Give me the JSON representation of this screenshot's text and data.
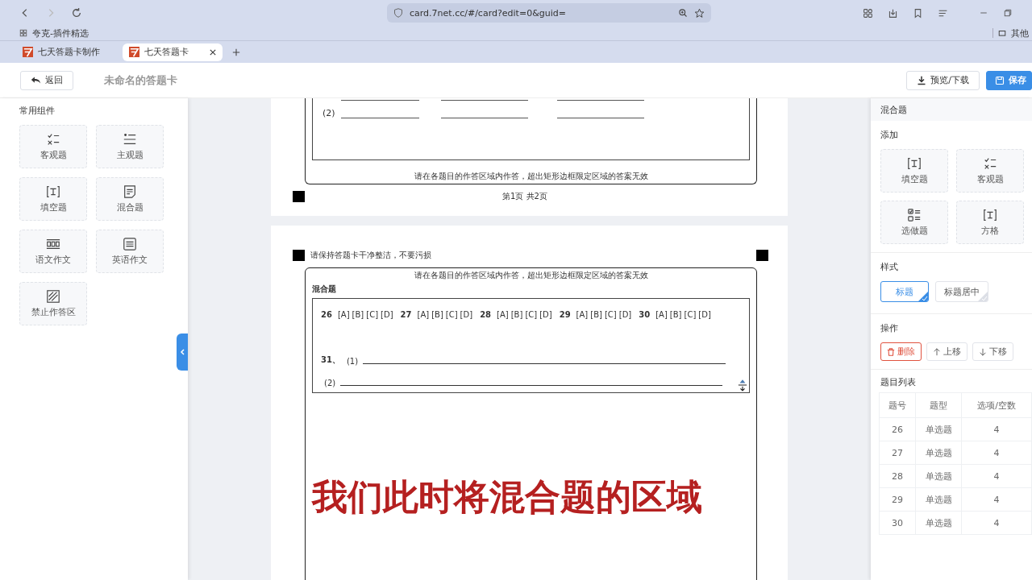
{
  "browser": {
    "url": "card.7net.cc/#/card?edit=0&guid=",
    "bookmarks": [
      "夸克-插件精选"
    ],
    "bookmark_folder": "其他",
    "tabs": [
      {
        "label": "七天答题卡制作",
        "selected": false
      },
      {
        "label": "七天答题卡",
        "selected": true
      }
    ]
  },
  "header": {
    "back_button": "返回",
    "title": "未命名的答题卡",
    "preview_button": "预览/下载",
    "save_button": "保存"
  },
  "left_panel": {
    "title": "常用组件",
    "components": [
      "客观题",
      "主观题",
      "填空题",
      "混合题",
      "语文作文",
      "英语作文",
      "禁止作答区"
    ]
  },
  "page_1": {
    "blank_label": "(2)",
    "answer_note": "请在各题目的作答区域内作答，超出矩形边框限定区域的答案无效",
    "page_number": "第1页 共2页"
  },
  "page_2": {
    "notice": "请保持答题卡干净整洁，不要污损",
    "answer_note": "请在各题目的作答区域内作答，超出矩形边框限定区域的答案无效",
    "section_title": "混合题",
    "choices": [
      {
        "number": "26",
        "options": [
          "[A]",
          "[B]",
          "[C]",
          "[D]"
        ]
      },
      {
        "number": "27",
        "options": [
          "[A]",
          "[B]",
          "[C]",
          "[D]"
        ]
      },
      {
        "number": "28",
        "options": [
          "[A]",
          "[B]",
          "[C]",
          "[D]"
        ]
      },
      {
        "number": "29",
        "options": [
          "[A]",
          "[B]",
          "[C]",
          "[D]"
        ]
      },
      {
        "number": "30",
        "options": [
          "[A]",
          "[B]",
          "[C]",
          "[D]"
        ]
      }
    ],
    "fill": {
      "number": "31、",
      "parts": [
        "(1)",
        "(2)"
      ]
    }
  },
  "caption": "我们此时将混合题的区域",
  "right_panel": {
    "title": "混合题",
    "add_label": "添加",
    "add_items": [
      "填空题",
      "客观题",
      "选做题",
      "方格"
    ],
    "style_label": "样式",
    "style_options": [
      {
        "label": "标题",
        "selected": true
      },
      {
        "label": "标题居中",
        "selected": false
      }
    ],
    "ops_label": "操作",
    "ops": [
      {
        "label": "删除",
        "kind": "delete"
      },
      {
        "label": "上移",
        "kind": "up"
      },
      {
        "label": "下移",
        "kind": "down"
      }
    ],
    "list_title": "题目列表",
    "columns": [
      "题号",
      "题型",
      "选项/空数"
    ],
    "rows": [
      [
        "26",
        "单选题",
        "4"
      ],
      [
        "27",
        "单选题",
        "4"
      ],
      [
        "28",
        "单选题",
        "4"
      ],
      [
        "29",
        "单选题",
        "4"
      ],
      [
        "30",
        "单选题",
        "4"
      ]
    ]
  }
}
